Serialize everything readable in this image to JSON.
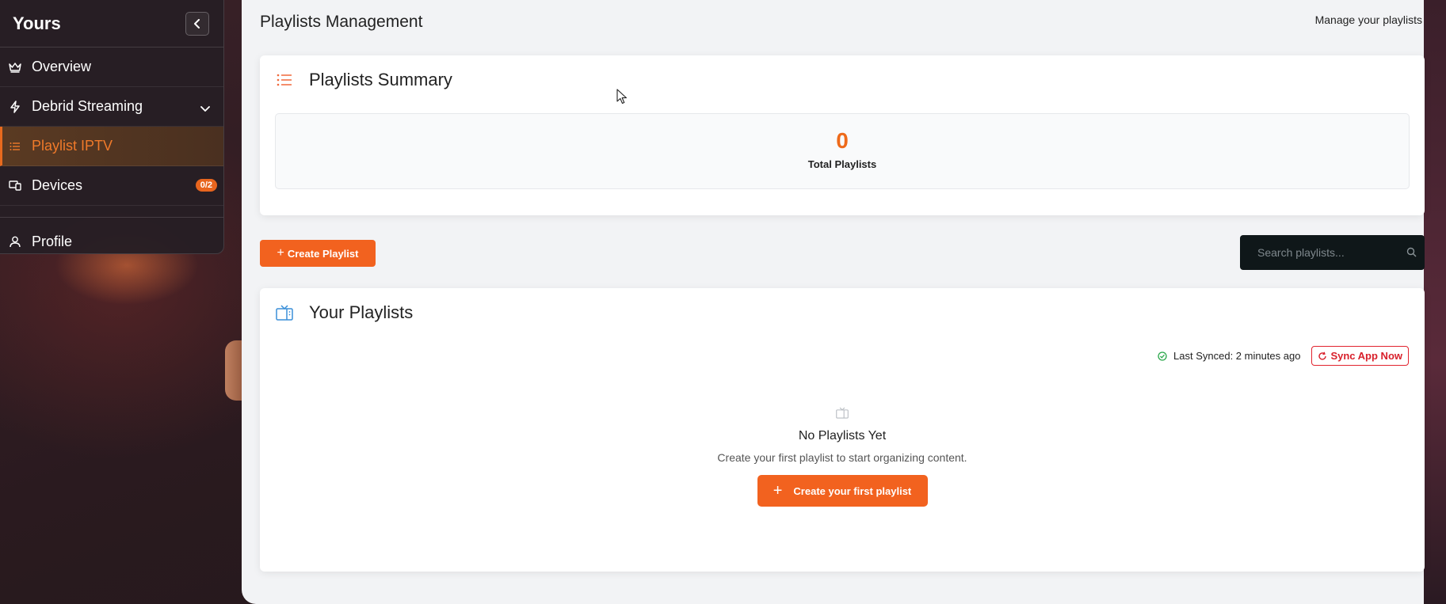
{
  "sidebar": {
    "brand": "Yours",
    "items": [
      {
        "label": "Overview",
        "icon": "crown-icon"
      },
      {
        "label": "Debrid Streaming",
        "icon": "bolt-icon"
      },
      {
        "label": "Playlist IPTV",
        "icon": "list-icon"
      },
      {
        "label": "Devices",
        "icon": "devices-icon",
        "badge": "0/2"
      },
      {
        "label": "Profile",
        "icon": "user-icon"
      }
    ]
  },
  "header": {
    "title": "Playlists Management",
    "subtitle": "Manage your playlists"
  },
  "summary": {
    "title": "Playlists Summary",
    "total_value": "0",
    "total_label": "Total Playlists"
  },
  "toolbar": {
    "create_label": "Create Playlist",
    "search_placeholder": "Search playlists..."
  },
  "playlists": {
    "title": "Your Playlists",
    "last_synced": "Last Synced: 2 minutes ago",
    "sync_label": "Sync App Now",
    "empty_title": "No Playlists Yet",
    "empty_desc": "Create your first playlist to start organizing content.",
    "first_button": "Create your first playlist"
  },
  "colors": {
    "accent": "#f2621f",
    "accent_text": "#ee6a1a",
    "sync_red": "#d8202b",
    "sidebar_bg": "#261e24"
  }
}
